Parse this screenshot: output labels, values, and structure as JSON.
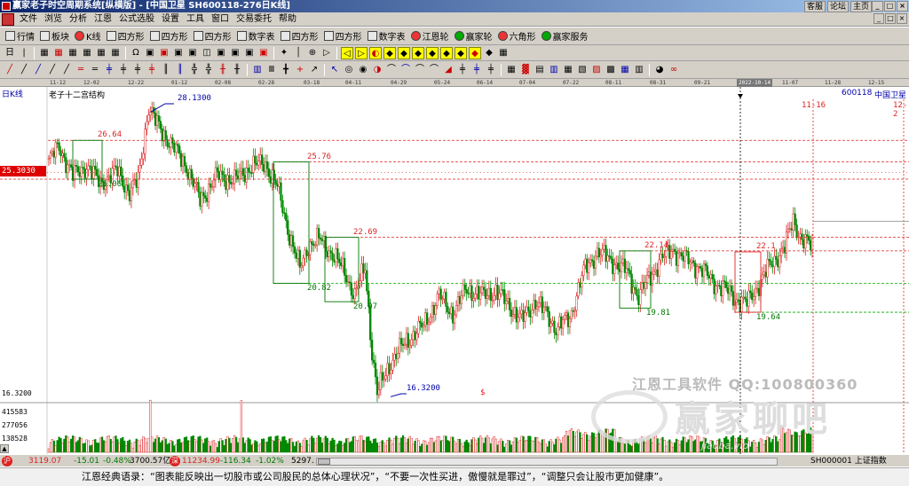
{
  "window": {
    "title": "赢家老子时空周期系统[纵横版] - [中国卫星  SH600118-276日K线]",
    "title_links": [
      "客服",
      "论坛",
      "主页"
    ],
    "controls": [
      "_",
      "□",
      "×"
    ]
  },
  "menu": {
    "items": [
      "文件",
      "浏览",
      "分析",
      "江恩",
      "公式选股",
      "设置",
      "工具",
      "窗口",
      "交易委托",
      "帮助"
    ],
    "mdi_controls": [
      "_",
      "□",
      "×"
    ]
  },
  "toolbar1": [
    {
      "label": "行情",
      "icon": "grid-icon"
    },
    {
      "label": "板块",
      "icon": "grid-icon"
    },
    {
      "label": "K线",
      "icon": "candle-icon"
    },
    {
      "label": "四方形",
      "icon": "square-icon"
    },
    {
      "label": "四方形",
      "icon": "square-icon"
    },
    {
      "label": "四方形",
      "icon": "square-icon"
    },
    {
      "label": "数字表",
      "icon": "table-icon"
    },
    {
      "label": "四方形",
      "icon": "square-icon"
    },
    {
      "label": "四方形",
      "icon": "square-icon"
    },
    {
      "label": "数字表",
      "icon": "table-icon"
    },
    {
      "label": "江恩轮",
      "icon": "wheel-icon"
    },
    {
      "label": "赢家轮",
      "icon": "wheel-icon"
    },
    {
      "label": "六角形",
      "icon": "hexagon-icon"
    },
    {
      "label": "赢家服务",
      "icon": "service-icon"
    }
  ],
  "toolbar2_count": 34,
  "toolbar3_count": 46,
  "date_axis": [
    "11-12",
    "12-02",
    "12-22",
    "01-12",
    "02-08",
    "02-28",
    "03-18",
    "04-11",
    "04-29",
    "05-24",
    "06-14",
    "07-04",
    "07-22",
    "08-11",
    "08-31",
    "09-21",
    "2022-10-14",
    "11-07",
    "11-28",
    "12-15"
  ],
  "date_highlight": "2022-10-14",
  "chart": {
    "period_label": "日K线",
    "name": "老子十二宫结构",
    "code": "600118",
    "stock_name": "中国卫星",
    "current_price_tag": "25.3030",
    "y_axis_label": "16.3200",
    "volume_labels": [
      "415583",
      "277056",
      "138528"
    ],
    "signal_marker": "$",
    "crosshair_date": "2022-10-14",
    "top_right_labels": [
      "11-16",
      "12-2"
    ],
    "watermarks": {
      "company": "江恩工具软件    QQ:100800360",
      "brand": "赢家聊吧",
      "url": "jiaoba.vip"
    }
  },
  "chart_data": {
    "type": "candlestick",
    "title": "老子十二宫结构",
    "symbol": "SH600118",
    "name": "中国卫星",
    "period": "日K线",
    "x_range": [
      "2021-11",
      "2022-12"
    ],
    "ylim": [
      16.32,
      28.13
    ],
    "levels": [
      {
        "label": "28.1300",
        "value": 28.13,
        "color": "blue",
        "kind": "high"
      },
      {
        "label": "26.64",
        "value": 26.64,
        "color": "red",
        "kind": "resistance"
      },
      {
        "label": "25.76",
        "value": 25.76,
        "color": "red",
        "kind": "resistance"
      },
      {
        "label": "25.06",
        "value": 25.06,
        "color": "green",
        "kind": "support"
      },
      {
        "label": "22.69",
        "value": 22.69,
        "color": "red",
        "kind": "resistance"
      },
      {
        "label": "22.14",
        "value": 22.14,
        "color": "red",
        "kind": "resistance"
      },
      {
        "label": "22.1",
        "value": 22.1,
        "color": "red",
        "kind": "resistance"
      },
      {
        "label": "20.82",
        "value": 20.82,
        "color": "green",
        "kind": "support"
      },
      {
        "label": "20.07",
        "value": 20.07,
        "color": "green",
        "kind": "support"
      },
      {
        "label": "19.81",
        "value": 19.81,
        "color": "green",
        "kind": "support"
      },
      {
        "label": "19.64",
        "value": 19.64,
        "color": "green",
        "kind": "support"
      },
      {
        "label": "16.3200",
        "value": 16.32,
        "color": "blue",
        "kind": "low"
      }
    ],
    "key_points": [
      {
        "date": "2022-01-12",
        "price": 28.13,
        "note": "high"
      },
      {
        "date": "2022-04-27",
        "price": 16.32,
        "note": "low"
      }
    ],
    "volume_ticks": [
      138528,
      277056,
      415583
    ]
  },
  "status": {
    "sh_index": "3119.07",
    "sh_change": "-15.01",
    "sh_pct": "-0.48%",
    "sh_amount": "3700.57亿",
    "sz_index": "11234.99",
    "sz_change": "-116.34",
    "sz_pct": "-1.02%",
    "sz_amount": "5297.",
    "right_code": "SH000001 上证指数"
  },
  "footer": {
    "quote": "江恩经典语录：“图表能反映出一切股市或公司股民的总体心理状况”，“不要一次性买进，傲慢就是罪过”，“调整只会让股市更加健康”。"
  },
  "colors": {
    "up": "#dd2222",
    "down": "#008800",
    "title_bar": "#0a246a",
    "chrome": "#d4d0c8"
  }
}
